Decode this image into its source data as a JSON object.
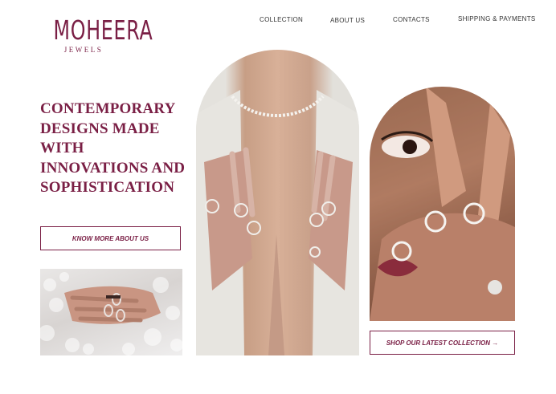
{
  "brand": {
    "name": "MOHEERA",
    "tagline": "JEWELS"
  },
  "nav": {
    "collection": "COLLECTION",
    "about": "ABOUT US",
    "contacts": "CONTACTS",
    "shipping": "SHIPPING & PAYMENTS"
  },
  "hero": {
    "headline_lines": [
      "CONTEMPORARY",
      "DESIGNS MADE WITH",
      "INNOVATIONS AND",
      "SOPHISTICATION"
    ],
    "know_more_label": "KNOW MORE ABOUT US",
    "shop_label": "SHOP OUR LATEST COLLECTION →"
  },
  "colors": {
    "brand": "#7a1f45",
    "nav_text": "#333333",
    "background": "#ffffff"
  },
  "images": {
    "hand_in_foam": "photo-hands-in-foam",
    "model_necklace": "photo-model-necklace-rings",
    "model_face": "photo-model-face-rings"
  }
}
